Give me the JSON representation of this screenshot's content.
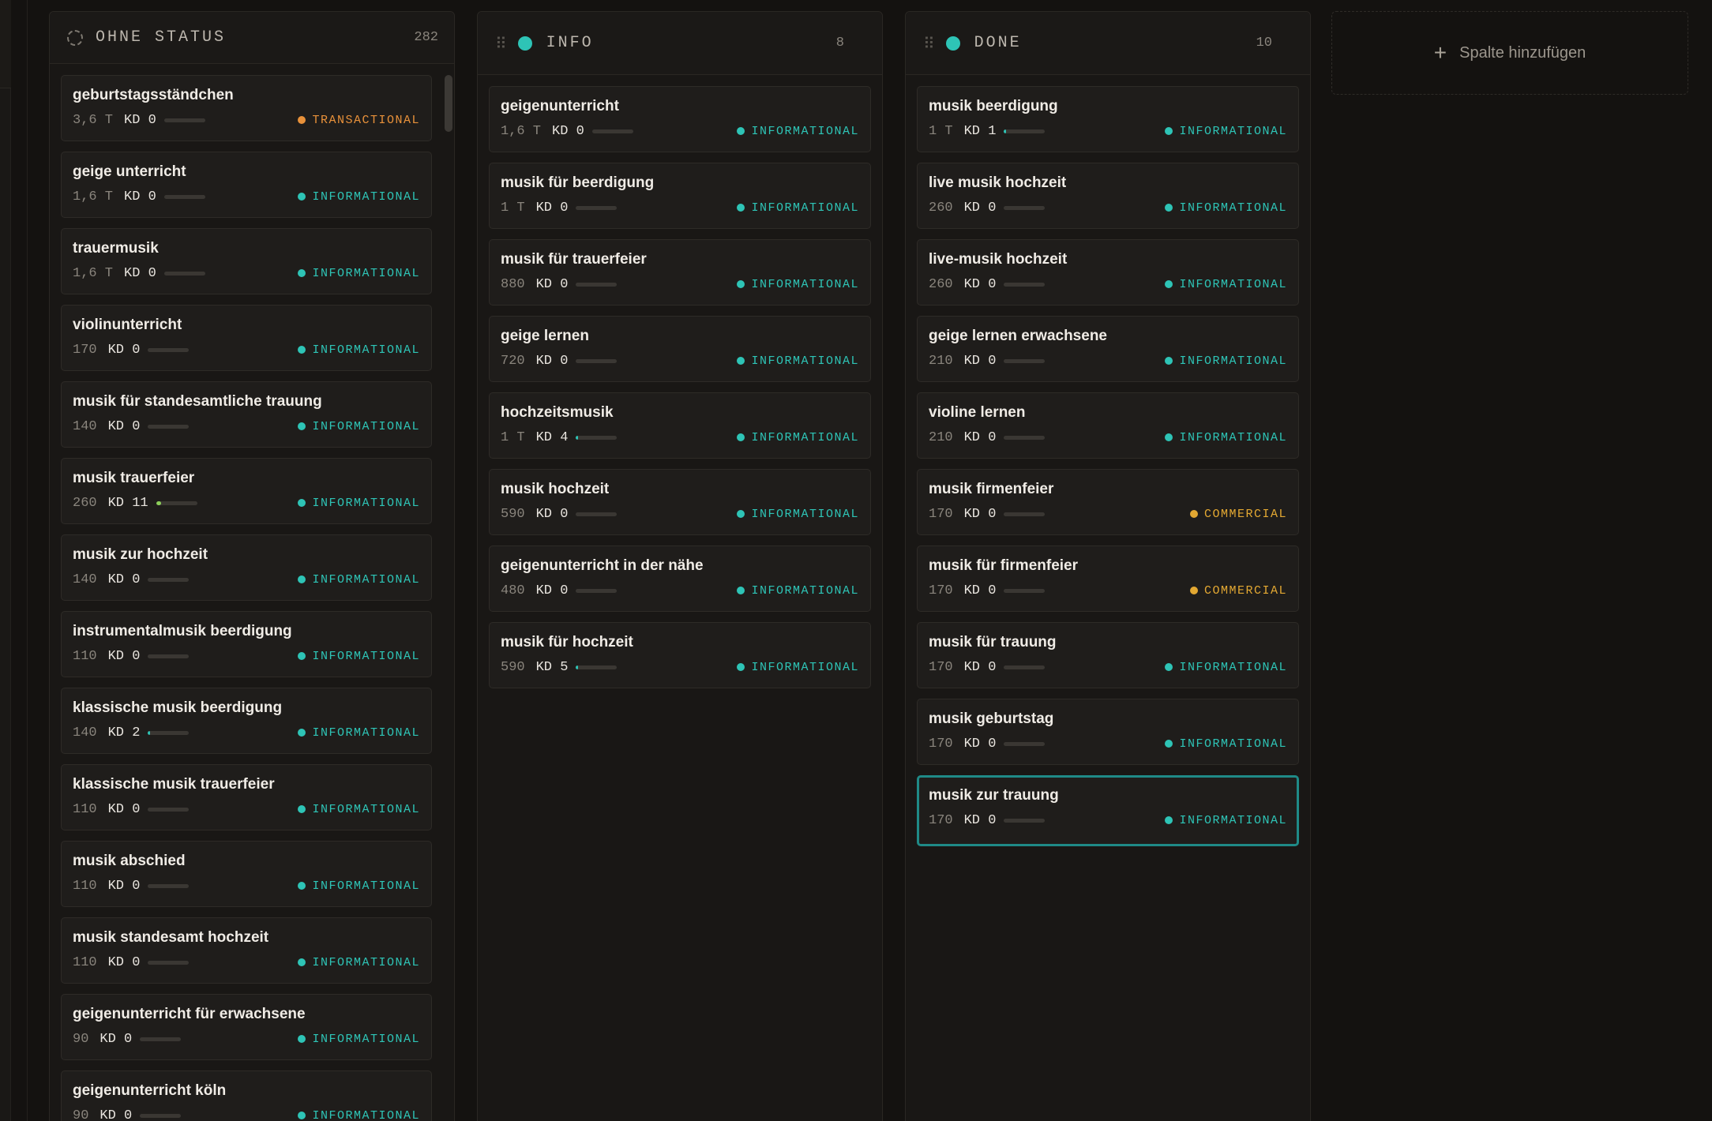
{
  "columns": [
    {
      "id": "ohne-status",
      "title": "OHNE STATUS",
      "count": "282",
      "cards": [
        {
          "title": "geburtstagsständchen",
          "volume": "3,6 T",
          "kd_label": "KD 0",
          "kd": 0,
          "intent": "TRANSACTIONAL",
          "intent_type": "transactional"
        },
        {
          "title": "geige unterricht",
          "volume": "1,6 T",
          "kd_label": "KD 0",
          "kd": 0,
          "intent": "INFORMATIONAL",
          "intent_type": "informational"
        },
        {
          "title": "trauermusik",
          "volume": "1,6 T",
          "kd_label": "KD 0",
          "kd": 0,
          "intent": "INFORMATIONAL",
          "intent_type": "informational"
        },
        {
          "title": "violinunterricht",
          "volume": "170",
          "kd_label": "KD 0",
          "kd": 0,
          "intent": "INFORMATIONAL",
          "intent_type": "informational"
        },
        {
          "title": "musik für standesamtliche trauung",
          "volume": "140",
          "kd_label": "KD 0",
          "kd": 0,
          "intent": "INFORMATIONAL",
          "intent_type": "informational"
        },
        {
          "title": "musik trauerfeier",
          "volume": "260",
          "kd_label": "KD 11",
          "kd": 11,
          "intent": "INFORMATIONAL",
          "intent_type": "informational"
        },
        {
          "title": "musik zur hochzeit",
          "volume": "140",
          "kd_label": "KD 0",
          "kd": 0,
          "intent": "INFORMATIONAL",
          "intent_type": "informational"
        },
        {
          "title": "instrumentalmusik beerdigung",
          "volume": "110",
          "kd_label": "KD 0",
          "kd": 0,
          "intent": "INFORMATIONAL",
          "intent_type": "informational"
        },
        {
          "title": "klassische musik beerdigung",
          "volume": "140",
          "kd_label": "KD 2",
          "kd": 2,
          "intent": "INFORMATIONAL",
          "intent_type": "informational"
        },
        {
          "title": "klassische musik trauerfeier",
          "volume": "110",
          "kd_label": "KD 0",
          "kd": 0,
          "intent": "INFORMATIONAL",
          "intent_type": "informational"
        },
        {
          "title": "musik abschied",
          "volume": "110",
          "kd_label": "KD 0",
          "kd": 0,
          "intent": "INFORMATIONAL",
          "intent_type": "informational"
        },
        {
          "title": "musik standesamt hochzeit",
          "volume": "110",
          "kd_label": "KD 0",
          "kd": 0,
          "intent": "INFORMATIONAL",
          "intent_type": "informational"
        },
        {
          "title": "geigenunterricht für erwachsene",
          "volume": "90",
          "kd_label": "KD 0",
          "kd": 0,
          "intent": "INFORMATIONAL",
          "intent_type": "informational"
        },
        {
          "title": "geigenunterricht köln",
          "volume": "90",
          "kd_label": "KD 0",
          "kd": 0,
          "intent": "INFORMATIONAL",
          "intent_type": "informational"
        }
      ]
    },
    {
      "id": "info",
      "title": "INFO",
      "count": "8",
      "cards": [
        {
          "title": "geigenunterricht",
          "volume": "1,6 T",
          "kd_label": "KD 0",
          "kd": 0,
          "intent": "INFORMATIONAL",
          "intent_type": "informational"
        },
        {
          "title": "musik für beerdigung",
          "volume": "1 T",
          "kd_label": "KD 0",
          "kd": 0,
          "intent": "INFORMATIONAL",
          "intent_type": "informational"
        },
        {
          "title": "musik für trauerfeier",
          "volume": "880",
          "kd_label": "KD 0",
          "kd": 0,
          "intent": "INFORMATIONAL",
          "intent_type": "informational"
        },
        {
          "title": "geige lernen",
          "volume": "720",
          "kd_label": "KD 0",
          "kd": 0,
          "intent": "INFORMATIONAL",
          "intent_type": "informational"
        },
        {
          "title": "hochzeitsmusik",
          "volume": "1 T",
          "kd_label": "KD 4",
          "kd": 4,
          "intent": "INFORMATIONAL",
          "intent_type": "informational"
        },
        {
          "title": "musik hochzeit",
          "volume": "590",
          "kd_label": "KD 0",
          "kd": 0,
          "intent": "INFORMATIONAL",
          "intent_type": "informational"
        },
        {
          "title": "geigenunterricht in der nähe",
          "volume": "480",
          "kd_label": "KD 0",
          "kd": 0,
          "intent": "INFORMATIONAL",
          "intent_type": "informational"
        },
        {
          "title": "musik für hochzeit",
          "volume": "590",
          "kd_label": "KD 5",
          "kd": 5,
          "intent": "INFORMATIONAL",
          "intent_type": "informational"
        }
      ]
    },
    {
      "id": "done",
      "title": "DONE",
      "count": "10",
      "cards": [
        {
          "title": "musik beerdigung",
          "volume": "1 T",
          "kd_label": "KD 1",
          "kd": 1,
          "intent": "INFORMATIONAL",
          "intent_type": "informational"
        },
        {
          "title": "live musik hochzeit",
          "volume": "260",
          "kd_label": "KD 0",
          "kd": 0,
          "intent": "INFORMATIONAL",
          "intent_type": "informational"
        },
        {
          "title": "live-musik hochzeit",
          "volume": "260",
          "kd_label": "KD 0",
          "kd": 0,
          "intent": "INFORMATIONAL",
          "intent_type": "informational"
        },
        {
          "title": "geige lernen erwachsene",
          "volume": "210",
          "kd_label": "KD 0",
          "kd": 0,
          "intent": "INFORMATIONAL",
          "intent_type": "informational"
        },
        {
          "title": "violine lernen",
          "volume": "210",
          "kd_label": "KD 0",
          "kd": 0,
          "intent": "INFORMATIONAL",
          "intent_type": "informational"
        },
        {
          "title": "musik firmenfeier",
          "volume": "170",
          "kd_label": "KD 0",
          "kd": 0,
          "intent": "COMMERCIAL",
          "intent_type": "commercial"
        },
        {
          "title": "musik für firmenfeier",
          "volume": "170",
          "kd_label": "KD 0",
          "kd": 0,
          "intent": "COMMERCIAL",
          "intent_type": "commercial"
        },
        {
          "title": "musik für trauung",
          "volume": "170",
          "kd_label": "KD 0",
          "kd": 0,
          "intent": "INFORMATIONAL",
          "intent_type": "informational"
        },
        {
          "title": "musik geburtstag",
          "volume": "170",
          "kd_label": "KD 0",
          "kd": 0,
          "intent": "INFORMATIONAL",
          "intent_type": "informational"
        },
        {
          "title": "musik zur trauung",
          "volume": "170",
          "kd_label": "KD 0",
          "kd": 0,
          "intent": "INFORMATIONAL",
          "intent_type": "informational",
          "selected": true
        }
      ]
    }
  ],
  "add_column": {
    "label": "Spalte hinzufügen",
    "icon": "plus-icon"
  },
  "colors": {
    "accent": "#2ec4b6",
    "transactional": "#e8913a",
    "commercial": "#e3a832",
    "selected_border": "#1f8a87",
    "background": "#141210"
  }
}
